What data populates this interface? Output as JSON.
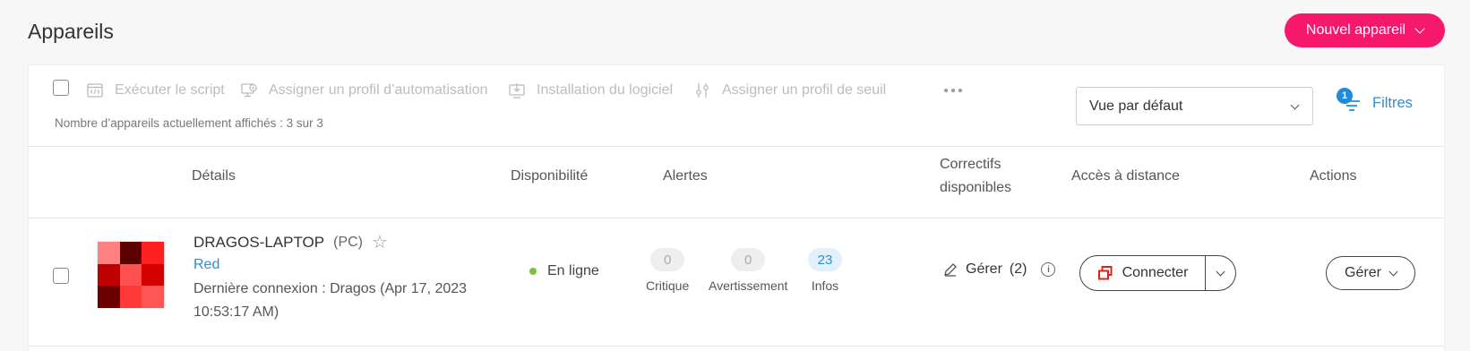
{
  "page": {
    "title": "Appareils"
  },
  "header": {
    "new_device_label": "Nouvel appareil"
  },
  "toolbar": {
    "run_script": "Exécuter le script",
    "assign_automation": "Assigner un profil d’automatisation",
    "install_software": "Installation du logiciel",
    "assign_threshold": "Assigner un profil de seuil",
    "device_count": "Nombre d’appareils actuellement affichés : 3 sur 3"
  },
  "view": {
    "selected": "Vue par défaut"
  },
  "filters": {
    "label": "Filtres",
    "count": "1"
  },
  "columns": {
    "details": "Détails",
    "availability": "Disponibilité",
    "alerts": "Alertes",
    "patches_line1": "Correctifs",
    "patches_line2": "disponibles",
    "remote": "Accès à distance",
    "actions": "Actions"
  },
  "device": {
    "name": "DRAGOS-LAPTOP",
    "type": "(PC)",
    "group": "Red",
    "last_login": "Dernière connexion : Dragos (Apr 17, 2023 10:53:17 AM)",
    "status": "En ligne",
    "alerts": {
      "critical": {
        "count": "0",
        "label": "Critique"
      },
      "warning": {
        "count": "0",
        "label": "Avertissement"
      },
      "info": {
        "count": "23",
        "label": "Infos"
      }
    },
    "patches": {
      "label": "Gérer",
      "count": "(2)"
    },
    "connect_label": "Connecter",
    "manage_label": "Gérer",
    "thumb_colors": [
      "#ff8080",
      "#5c0000",
      "#ff2020",
      "#c00000",
      "#ff5050",
      "#d40000",
      "#6a0000",
      "#ff3838",
      "#ff5555"
    ]
  },
  "colors": {
    "accent": "#f5186b",
    "link": "#2a8fd6",
    "online": "#7ac143"
  }
}
